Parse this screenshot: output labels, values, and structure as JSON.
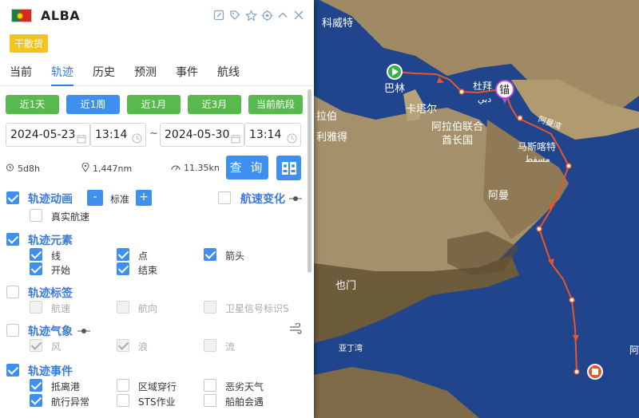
{
  "vessel": {
    "name": "ALBA",
    "badge": "干散货"
  },
  "header_icons": [
    "edit-icon",
    "tag-icon",
    "star-icon",
    "target-icon",
    "collapse-icon",
    "close-icon"
  ],
  "tabs": [
    {
      "label": "当前"
    },
    {
      "label": "轨迹"
    },
    {
      "label": "历史"
    },
    {
      "label": "预测"
    },
    {
      "label": "事件"
    },
    {
      "label": "航线"
    }
  ],
  "active_tab": "轨迹",
  "range_buttons": [
    {
      "label": "近1天"
    },
    {
      "label": "近1周"
    },
    {
      "label": "近1月"
    },
    {
      "label": "近3月"
    },
    {
      "label": "当前航段"
    }
  ],
  "active_range": "近1周",
  "date_from": {
    "date": "2024-05-23",
    "time": "13:14"
  },
  "date_to": {
    "date": "2024-05-30",
    "time": "13:14"
  },
  "date_separator": "~",
  "stats": {
    "duration": "5d8h",
    "distance": "1,447nm",
    "speed": "11.35kn"
  },
  "query_label": "查 询",
  "options": {
    "animation": {
      "title": "轨迹动画",
      "checked": true,
      "speed_label": "标准",
      "minus": "-",
      "plus": "+",
      "real_speed": "真实航速"
    },
    "speed_change": {
      "title": "航速变化",
      "checked": false
    },
    "elements": {
      "title": "轨迹元素",
      "checked": true,
      "items": [
        "线",
        "点",
        "箭头",
        "开始",
        "结束"
      ]
    },
    "labels": {
      "title": "轨迹标签",
      "checked": false,
      "items": [
        "航速",
        "航向",
        "卫星信号标识S"
      ]
    },
    "weather": {
      "title": "轨迹气象",
      "checked": false,
      "items": [
        "风",
        "浪",
        "流"
      ]
    },
    "events": {
      "title": "轨迹事件",
      "checked": true,
      "items": [
        "抵离港",
        "区域穿行",
        "恶劣天气",
        "航行异常",
        "STS作业",
        "船舶会遇"
      ]
    }
  },
  "map_labels": {
    "kuwait": "科威特",
    "bahrain": "巴林",
    "qatar": "卡塔尔",
    "dubai": "杜拜",
    "dubai_ar": "دبي",
    "uae_1": "阿拉伯联合",
    "uae_2": "酋长国",
    "muscat": "马斯喀特",
    "muscat_ar": "مسقط",
    "oman": "阿曼",
    "yemen": "也门",
    "saudi_partial": "拉伯",
    "riyadh_partial": "利雅得",
    "gulf_of_aden": "亚丁湾",
    "arab_partial": "阿曼湾",
    "anchor": "锚",
    "right_edge": "阿"
  },
  "colors": {
    "track": "#e5572a",
    "accent": "#3d8ff0",
    "green": "#58b94c",
    "badge": "#f4c320",
    "section": "#3d7bd8"
  }
}
